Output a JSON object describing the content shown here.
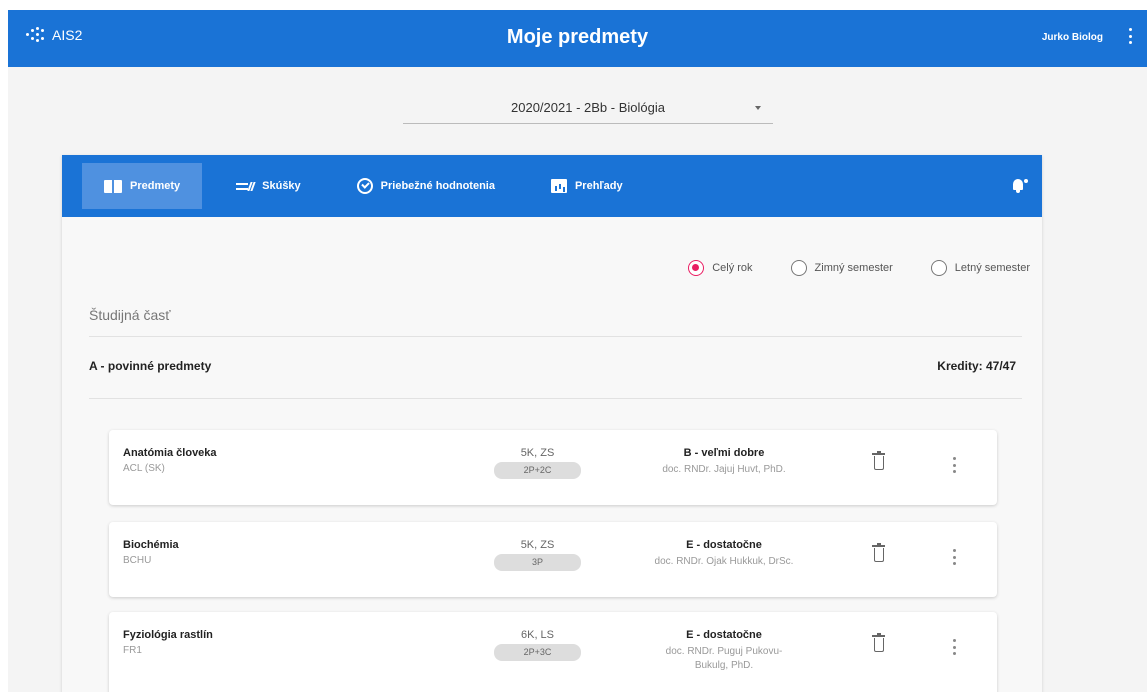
{
  "app": {
    "logo_text": "AIS2",
    "title": "Moje predmety",
    "user_name": "Jurko Biolog"
  },
  "period_select": {
    "value": "2020/2021 - 2Bb - Biológia"
  },
  "tabs": [
    {
      "label": "Predmety",
      "icon": "book-icon",
      "active": true
    },
    {
      "label": "Skúšky",
      "icon": "exam-sliders-icon",
      "active": false
    },
    {
      "label": "Priebežné hodnotenia",
      "icon": "cycle-check-icon",
      "active": false
    },
    {
      "label": "Prehľady",
      "icon": "chart-icon",
      "active": false
    }
  ],
  "semester_filter": [
    {
      "label": "Celý rok",
      "checked": true
    },
    {
      "label": "Zimný semester",
      "checked": false
    },
    {
      "label": "Letný semester",
      "checked": false
    }
  ],
  "section_title": "Študijná časť",
  "group": {
    "title": "A - povinné predmety",
    "credits": "Kredity: 47/47"
  },
  "courses": [
    {
      "name": "Anatómia človeka",
      "code": "ACL (SK)",
      "credits": "5K, ZS",
      "hours": "2P+2C",
      "grade": "B - veľmi dobre",
      "teacher": "doc. RNDr. Jajuj Huvt, PhD."
    },
    {
      "name": "Biochémia",
      "code": "BCHU",
      "credits": "5K, ZS",
      "hours": "3P",
      "grade": "E - dostatočne",
      "teacher": "doc. RNDr. Ojak Hukkuk, DrSc."
    },
    {
      "name": "Fyziológia rastlín",
      "code": "FR1",
      "credits": "6K, LS",
      "hours": "2P+3C",
      "grade": "E - dostatočne",
      "teacher": "doc. RNDr. Puguj Pukovu-Bukulg, PhD."
    }
  ],
  "colors": {
    "primary": "#1a73d6",
    "active_tab": "#4f91e0",
    "radio_accent": "#e91e63"
  }
}
